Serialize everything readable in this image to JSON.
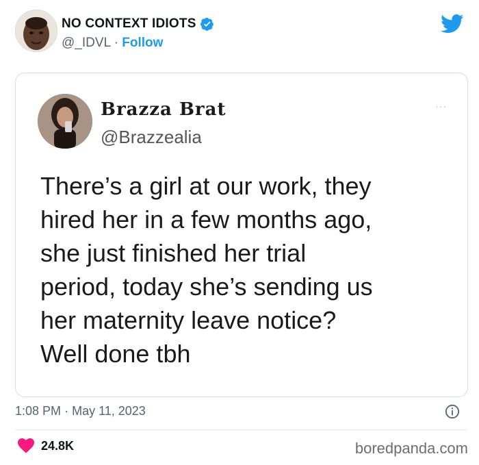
{
  "account": {
    "name": "NO CONTEXT IDIOTS",
    "handle": "@_IDVL",
    "separator": "·",
    "follow_label": "Follow"
  },
  "quoted_tweet": {
    "name": "Brazza Brat",
    "handle": "@Brazzealia",
    "menu_dots": "···",
    "lines": [
      "There’s a girl at our work, they",
      "hired her in a few months ago,",
      "she just finished her trial",
      "period, today she’s sending us",
      "her maternity leave notice?",
      "Well done tbh"
    ]
  },
  "meta": {
    "time": "1:08 PM",
    "separator": "·",
    "date": "May 11, 2023"
  },
  "engagement": {
    "likes": "24.8K"
  },
  "watermark": "boredpanda.com",
  "colors": {
    "accent": "#1d9bf0",
    "heart": "#f91880",
    "muted": "#536471"
  },
  "icons": [
    "verified-badge-icon",
    "twitter-bird-icon",
    "info-icon",
    "heart-icon"
  ]
}
